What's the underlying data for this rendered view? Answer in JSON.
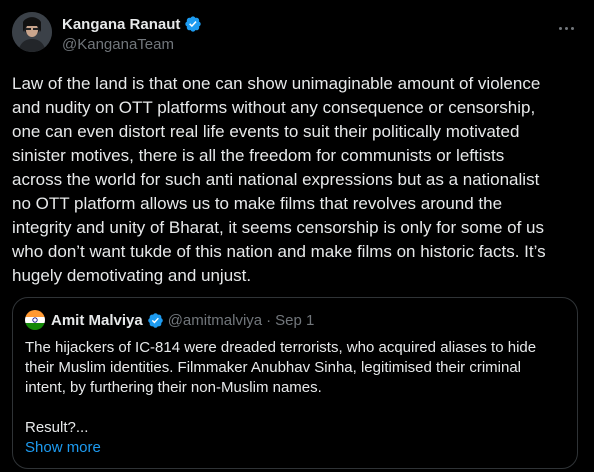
{
  "tweet": {
    "author": {
      "display_name": "Kangana Ranaut",
      "handle": "@KanganaTeam"
    },
    "text": "Law of the land is that one can show unimaginable amount of violence\nand nudity on OTT platforms without any consequence or censorship,\none can even distort real life events to suit their politically motivated\nsinister motives, there is all the freedom for communists or leftists\nacross the world for such anti national expressions but as a nationalist\nno OTT platform allows us to make films that revolves around the\nintegrity and unity of Bharat, it seems censorship is only for some of us\nwho don’t want tukde of this nation and make films on historic facts. It’s\nhugely demotivating and unjust."
  },
  "quote": {
    "author": {
      "display_name": "Amit Malviya",
      "handle": "@amitmalviya",
      "separator": "·",
      "date": "Sep 1"
    },
    "paragraph1": "The hijackers of IC-814 were dreaded terrorists, who acquired aliases to hide their Muslim identities. Filmmaker Anubhav Sinha, legitimised their criminal intent, by furthering their non-Muslim names.",
    "paragraph2": "Result?...",
    "show_more_label": "Show more"
  },
  "colors": {
    "background": "#000000",
    "text": "#e7e9ea",
    "secondary_text": "#71767b",
    "accent": "#1d9bf0",
    "border": "#2f3336"
  },
  "icons": {
    "verified": "verified-badge-icon",
    "more": "more-options-icon",
    "flag": "india-flag-avatar"
  }
}
